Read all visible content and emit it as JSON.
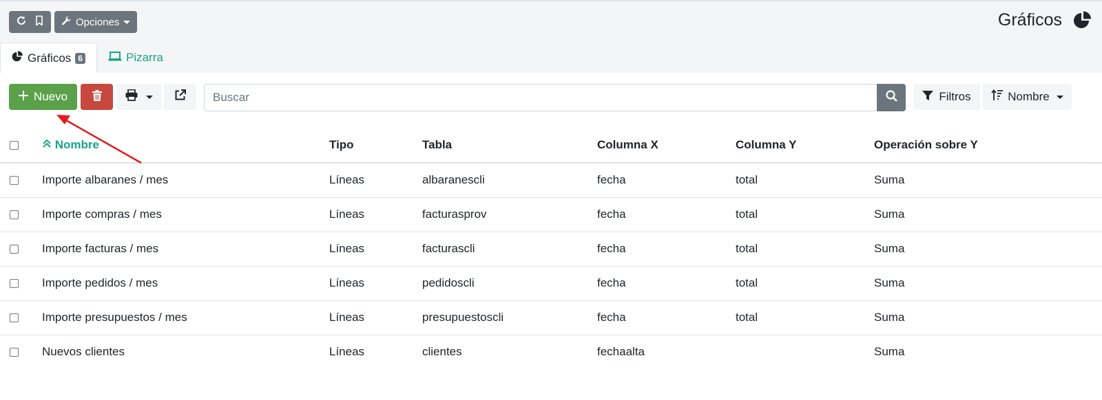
{
  "header": {
    "options_label": "Opciones",
    "page_title": "Gráficos"
  },
  "tabs": [
    {
      "label": "Gráficos",
      "badge": "6"
    },
    {
      "label": "Pizarra"
    }
  ],
  "toolbar": {
    "new_label": "Nuevo",
    "search_placeholder": "Buscar",
    "filters_label": "Filtros",
    "sort_label": "Nombre"
  },
  "table": {
    "columns": [
      "Nombre",
      "Tipo",
      "Tabla",
      "Columna X",
      "Columna Y",
      "Operación sobre Y"
    ],
    "rows": [
      [
        "Importe albaranes / mes",
        "Líneas",
        "albaranescli",
        "fecha",
        "total",
        "Suma"
      ],
      [
        "Importe compras / mes",
        "Líneas",
        "facturasprov",
        "fecha",
        "total",
        "Suma"
      ],
      [
        "Importe facturas / mes",
        "Líneas",
        "facturascli",
        "fecha",
        "total",
        "Suma"
      ],
      [
        "Importe pedidos / mes",
        "Líneas",
        "pedidoscli",
        "fecha",
        "total",
        "Suma"
      ],
      [
        "Importe presupuestos / mes",
        "Líneas",
        "presupuestoscli",
        "fecha",
        "total",
        "Suma"
      ],
      [
        "Nuevos clientes",
        "Líneas",
        "clientes",
        "fechaalta",
        "",
        "Suma"
      ]
    ]
  },
  "colors": {
    "accent": "#17a589",
    "success": "#5aa14a",
    "danger": "#c7483f",
    "secondary": "#6c757d",
    "annotation_arrow": "#e8191a"
  },
  "icons": [
    "refresh-icon",
    "bookmark-icon",
    "wrench-icon",
    "pie-chart-icon",
    "laptop-icon",
    "plus-icon",
    "trash-icon",
    "print-icon",
    "external-link-icon",
    "search-icon",
    "filter-icon",
    "sort-icon",
    "chevron-double-up-icon"
  ]
}
